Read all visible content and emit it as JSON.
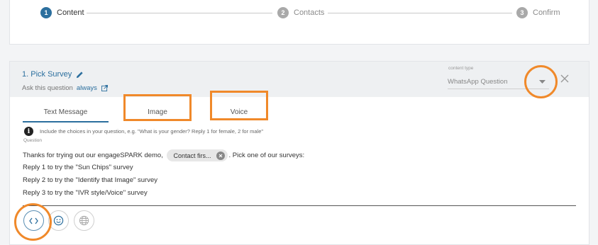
{
  "stepper": {
    "steps": [
      {
        "num": "1",
        "label": "Content"
      },
      {
        "num": "2",
        "label": "Contacts"
      },
      {
        "num": "3",
        "label": "Confirm"
      }
    ]
  },
  "question": {
    "title": "1. Pick Survey",
    "ask_prefix": "Ask this question",
    "ask_link": "always",
    "content_type_label": "content type",
    "content_type_value": "WhatsApp Question"
  },
  "tabs": [
    "Text Message",
    "Image",
    "Voice"
  ],
  "info": {
    "icon_char": "i",
    "text": "Include the choices in your question, e.g. \"What is your gender? Reply 1 for female, 2 for male\"",
    "question_label": "Question"
  },
  "message": {
    "line1_before": "Thanks for trying out our engageSPARK demo,",
    "chip": "Contact firs...",
    "line1_after": ". Pick one of our surveys:",
    "line2": "Reply 1 to try the \"Sun Chips\" survey",
    "line3": "Reply 2 to try the \"Identify that Image\" survey",
    "line4": "Reply 3 to try the \"IVR style/Voice\" survey"
  },
  "colors": {
    "accent": "#2c6f9e",
    "highlight": "#f0892a"
  }
}
